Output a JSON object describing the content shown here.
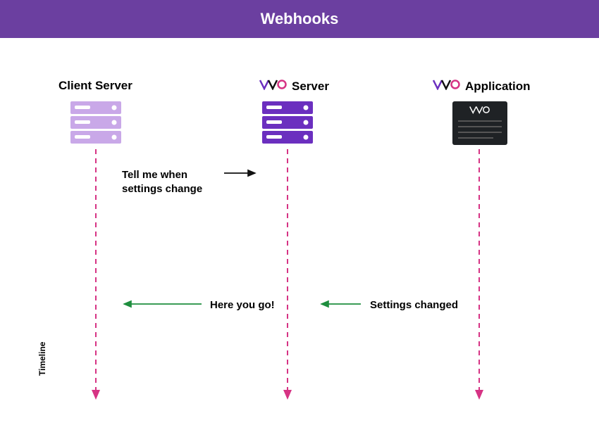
{
  "header": {
    "title": "Webhooks"
  },
  "columns": {
    "client": {
      "label": "Client Server"
    },
    "vwo_server": {
      "brand": "VWO",
      "label": "Server"
    },
    "vwo_app": {
      "brand": "VWO",
      "label": "Application"
    }
  },
  "messages": {
    "subscribe": "Tell me when settings change",
    "settings_changed": "Settings changed",
    "here_you_go": "Here you go!"
  },
  "axis": {
    "timeline": "Timeline"
  },
  "colors": {
    "header_bg": "#6b3fa0",
    "timeline_pink": "#d63384",
    "arrow_black": "#111111",
    "arrow_green": "#1e8e3e",
    "server_light": "#c9a8e8",
    "server_dark": "#6b2fbf",
    "app_panel": "#1f2225"
  }
}
